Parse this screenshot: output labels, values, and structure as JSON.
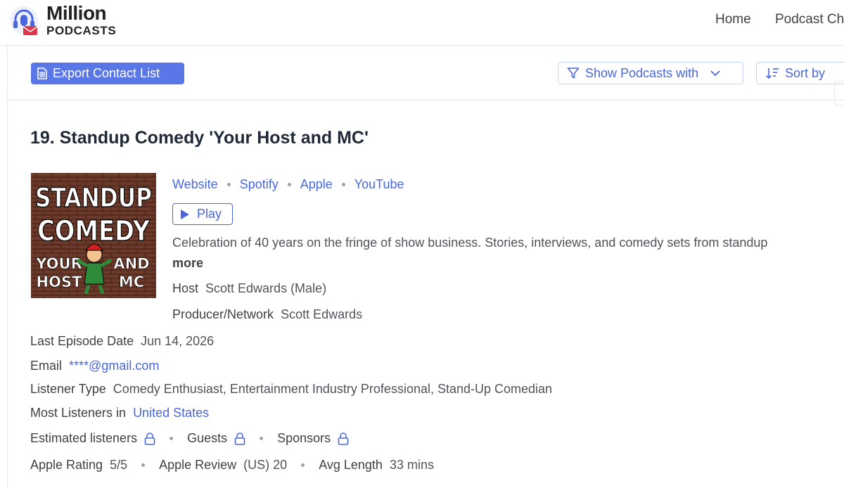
{
  "brand": {
    "line1": "Million",
    "line2": "PODCASTS"
  },
  "nav": {
    "home": "Home",
    "podcast": "Podcast Ch"
  },
  "toolbar": {
    "export_label": "Export Contact List",
    "filter_label": "Show Podcasts with",
    "sort_label": "Sort by"
  },
  "podcast": {
    "title": "19. Standup Comedy 'Your Host and MC'",
    "cover_text": {
      "line1": "STANDUP",
      "line2": "COMEDY",
      "left1": "YOUR",
      "left2": "HOST",
      "right1": "AND",
      "right2": "MC"
    },
    "links": [
      "Website",
      "Spotify",
      "Apple",
      "YouTube"
    ],
    "play_label": "Play",
    "description": "Celebration of 40 years on the fringe of show business. Stories, interviews, and comedy sets from standup",
    "more_label": "more",
    "host_label": "Host",
    "host_value": "Scott Edwards (Male)",
    "producer_label": "Producer/Network",
    "producer_value": "Scott Edwards",
    "last_episode_label": "Last Episode Date",
    "last_episode_value": "Jun 14, 2026",
    "email_label": "Email",
    "email_value": "****@gmail.com",
    "listener_type_label": "Listener Type",
    "listener_type_value": "Comedy Enthusiast, Entertainment Industry Professional, Stand-Up Comedian",
    "most_listeners_label": "Most Listeners in",
    "most_listeners_value": "United States",
    "locked_fields": [
      "Estimated listeners",
      "Guests",
      "Sponsors"
    ],
    "apple_rating_label": "Apple Rating",
    "apple_rating_value": "5/5",
    "apple_review_label": "Apple Review",
    "apple_review_value": "(US) 20",
    "avg_length_label": "Avg Length",
    "avg_length_value": "33 mins"
  },
  "colors": {
    "accent": "#4a66dc",
    "button_fill": "#5a77e8",
    "logo_red": "#e0354b"
  },
  "icons": [
    "headphones-logo-icon",
    "document-icon",
    "filter-icon",
    "chevron-down-icon",
    "sort-icon",
    "play-icon",
    "lock-icon"
  ]
}
